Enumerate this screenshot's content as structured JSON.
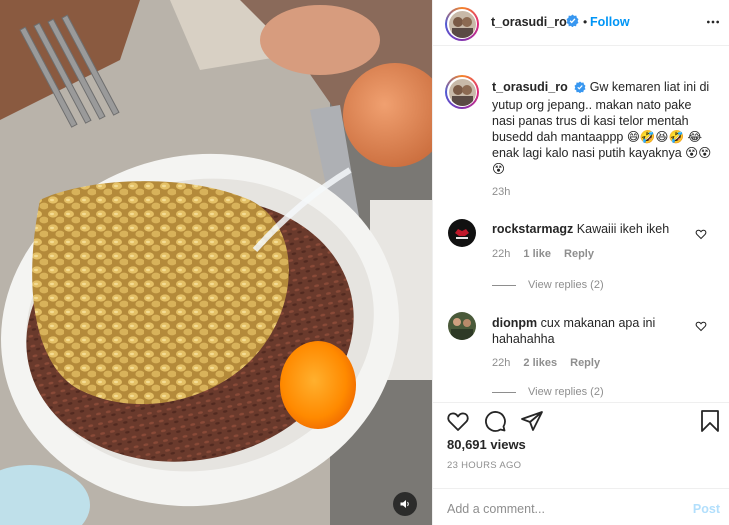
{
  "header": {
    "username": "t_orasudi_ro",
    "separator": "•",
    "follow_label": "Follow",
    "more_icon": "more-horizontal-icon"
  },
  "caption": {
    "username": "t_orasudi_ro",
    "text": "Gw kemaren liat ini di yutup org jepang.. makan nato pake nasi panas trus di kasi telor mentah busedd dah mantaappp 😄🤣😆🤣 😂 enak lagi kalo nasi putih kayaknya 😵😵😵",
    "time": "23h"
  },
  "comments": [
    {
      "username": "rockstarmagz",
      "text": "Kawaiii ikeh ikeh",
      "time": "22h",
      "likes": "1 like",
      "reply_label": "Reply",
      "view_replies": "View replies (2)"
    },
    {
      "username": "dionpm",
      "text": "cux makanan apa ini hahahahha",
      "time": "22h",
      "likes": "2 likes",
      "reply_label": "Reply",
      "view_replies": "View replies (2)"
    }
  ],
  "stats": {
    "views": "80,691 views",
    "posted": "23 HOURS AGO"
  },
  "add_comment": {
    "placeholder": "Add a comment...",
    "post_label": "Post"
  },
  "colors": {
    "link_blue": "#0095f6",
    "post_disabled": "#b2dffc",
    "muted": "#8e8e8e",
    "text": "#262626"
  }
}
